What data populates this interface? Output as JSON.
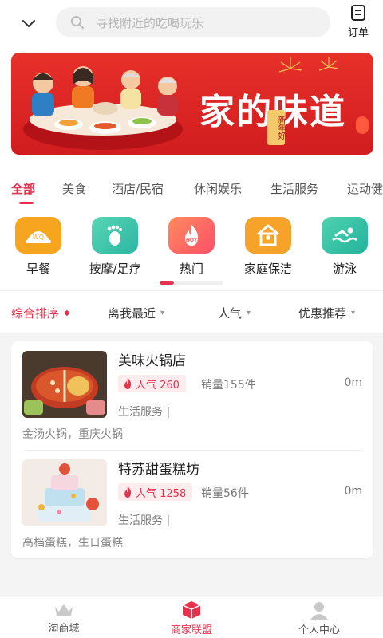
{
  "header": {
    "search_placeholder": "寻找附近的吃喝玩乐",
    "orders_label": "订单"
  },
  "banner": {
    "title": "家的味道",
    "tag": "新年好"
  },
  "tabs": [
    {
      "label": "全部",
      "active": true
    },
    {
      "label": "美食"
    },
    {
      "label": "酒店/民宿"
    },
    {
      "label": "休闲娱乐"
    },
    {
      "label": "生活服务"
    },
    {
      "label": "运动健"
    }
  ],
  "grid": [
    {
      "label": "早餐",
      "icon": "breakfast-icon",
      "color": "#f5a623"
    },
    {
      "label": "按摩/足疗",
      "icon": "foot-icon",
      "color": "#3ec6a8"
    },
    {
      "label": "热门",
      "icon": "hot-icon",
      "color": "#ff6b52"
    },
    {
      "label": "家庭保洁",
      "icon": "house-icon",
      "color": "#f7a229"
    },
    {
      "label": "游泳",
      "icon": "swim-icon",
      "color": "#33c2a6"
    }
  ],
  "filters": [
    {
      "label": "综合排序",
      "active": true
    },
    {
      "label": "离我最近"
    },
    {
      "label": "人气"
    },
    {
      "label": "优惠推荐"
    }
  ],
  "shops": [
    {
      "name": "美味火锅店",
      "popularity": "人气 260",
      "sales": "销量155件",
      "distance": "0m",
      "service": "生活服务 |",
      "tags": "金汤火锅，重庆火锅"
    },
    {
      "name": "特苏甜蛋糕坊",
      "popularity": "人气 1258",
      "sales": "销量56件",
      "distance": "0m",
      "service": "生活服务 |",
      "tags": "高档蛋糕，生日蛋糕"
    }
  ],
  "nav": [
    {
      "label": "淘商城",
      "icon": "crown-icon"
    },
    {
      "label": "商家联盟",
      "icon": "cube-icon",
      "active": true
    },
    {
      "label": "个人中心",
      "icon": "user-icon"
    }
  ],
  "colors": {
    "accent": "#e5334d",
    "banner": "#d11d1f"
  }
}
